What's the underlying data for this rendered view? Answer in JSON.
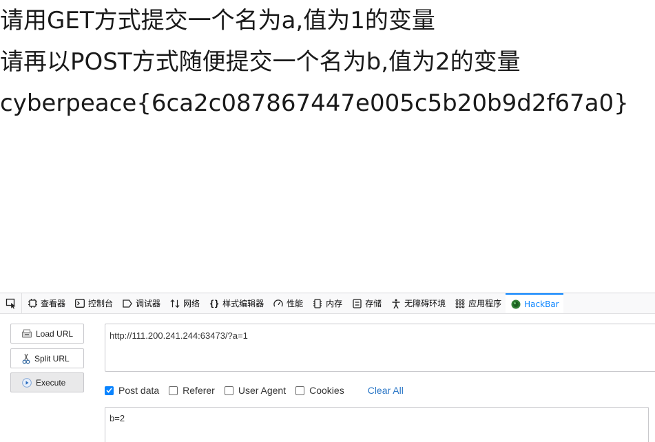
{
  "content": {
    "line1": "请用GET方式提交一个名为a,值为1的变量",
    "line2": "请再以POST方式随便提交一个名为b,值为2的变量",
    "line3": "cyberpeace{6ca2c087867447e005c5b20b9d2f67a0}"
  },
  "toolbar": {
    "tabs": [
      {
        "label": "查看器",
        "icon": "inspector-icon"
      },
      {
        "label": "控制台",
        "icon": "console-icon"
      },
      {
        "label": "调试器",
        "icon": "debugger-icon"
      },
      {
        "label": "网络",
        "icon": "network-icon"
      },
      {
        "label": "样式编辑器",
        "icon": "style-editor-icon"
      },
      {
        "label": "性能",
        "icon": "performance-icon"
      },
      {
        "label": "内存",
        "icon": "memory-icon"
      },
      {
        "label": "存储",
        "icon": "storage-icon"
      },
      {
        "label": "无障碍环境",
        "icon": "accessibility-icon"
      },
      {
        "label": "应用程序",
        "icon": "application-icon"
      },
      {
        "label": "HackBar",
        "icon": "hackbar-icon"
      }
    ],
    "active_tab": "HackBar",
    "accent_color": "#0a84ff"
  },
  "hackbar": {
    "load_url_label": "Load URL",
    "split_url_label": "Split URL",
    "execute_label": "Execute",
    "url_value": "http://111.200.241.244:63473/?a=1",
    "options": {
      "post_data": {
        "label": "Post data",
        "checked": true
      },
      "referer": {
        "label": "Referer",
        "checked": false
      },
      "user_agent": {
        "label": "User Agent",
        "checked": false
      },
      "cookies": {
        "label": "Cookies",
        "checked": false
      }
    },
    "clear_all_label": "Clear All",
    "post_body_value": "b=2"
  }
}
